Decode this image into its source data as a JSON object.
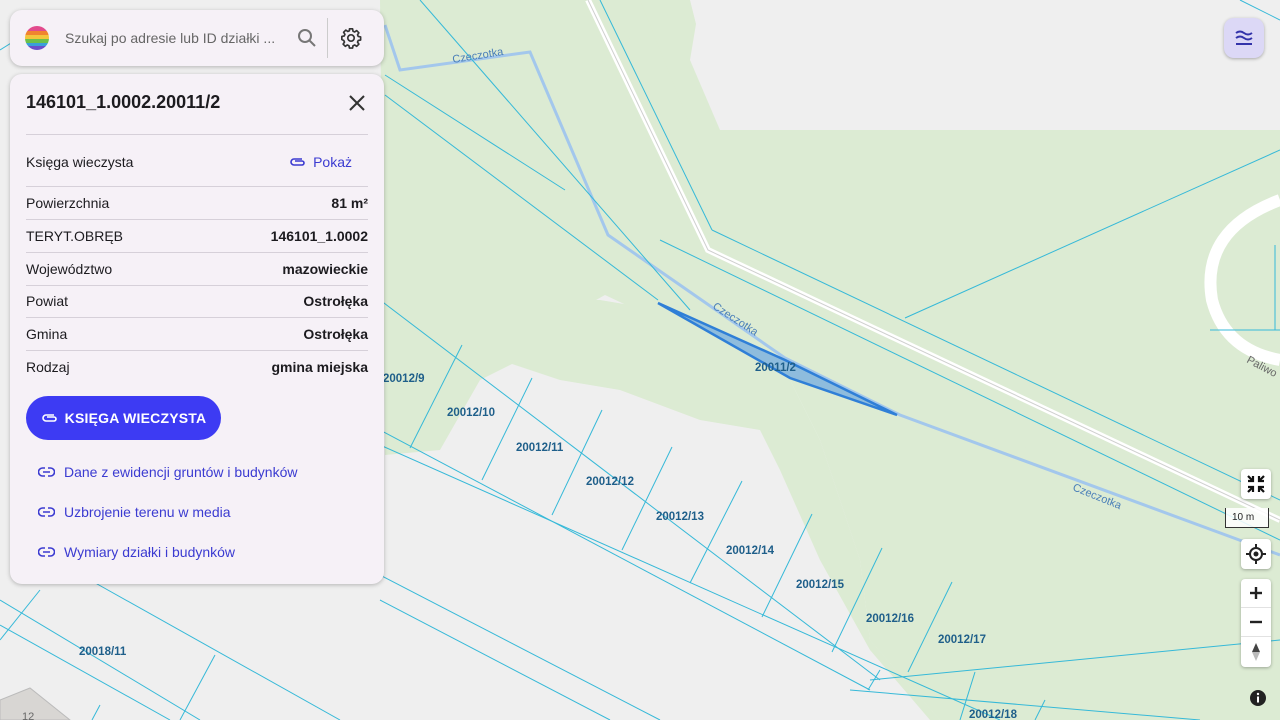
{
  "search": {
    "placeholder": "Szukaj po adresie lub ID działki ..."
  },
  "panel": {
    "title": "146101_1.0002.20011/2",
    "land_register": {
      "label": "Księga wieczysta",
      "link": "Pokaż"
    },
    "rows": [
      {
        "label": "Powierzchnia",
        "value": "81 m²"
      },
      {
        "label": "TERYT.OBRĘB",
        "value": "146101_1.0002"
      },
      {
        "label": "Województwo",
        "value": "mazowieckie"
      },
      {
        "label": "Powiat",
        "value": "Ostrołęka"
      },
      {
        "label": "Gmina",
        "value": "Ostrołęka"
      },
      {
        "label": "Rodzaj",
        "value": "gmina miejska"
      }
    ],
    "primary_button": "KSIĘGA WIECZYSTA",
    "links": [
      "Dane z ewidencji gruntów i budynków",
      "Uzbrojenie terenu w media",
      "Wymiary działki i budynków"
    ]
  },
  "map": {
    "parcel_labels": [
      "20011/2",
      "20012/9",
      "20012/10",
      "20012/11",
      "20012/12",
      "20012/13",
      "20012/14",
      "20012/15",
      "20012/16",
      "20012/17",
      "20012/18",
      "20018/11"
    ],
    "river_name": "Czeczotka",
    "street_name": "Paliwo",
    "building_number": "12",
    "scale_label": "10 m",
    "colors": {
      "forest": "#dcebd3",
      "parcel_line": "#36b9d8",
      "river": "#a3c7ec",
      "selected": "#2f7fd7",
      "road": "#ffffff"
    }
  },
  "icons": [
    "logo-icon",
    "search-icon",
    "gear-icon",
    "close-icon",
    "attachment-icon",
    "link-icon",
    "layers-icon",
    "exit-fullscreen-icon",
    "locate-icon",
    "zoom-in-icon",
    "zoom-out-icon",
    "compass-icon",
    "info-icon"
  ]
}
